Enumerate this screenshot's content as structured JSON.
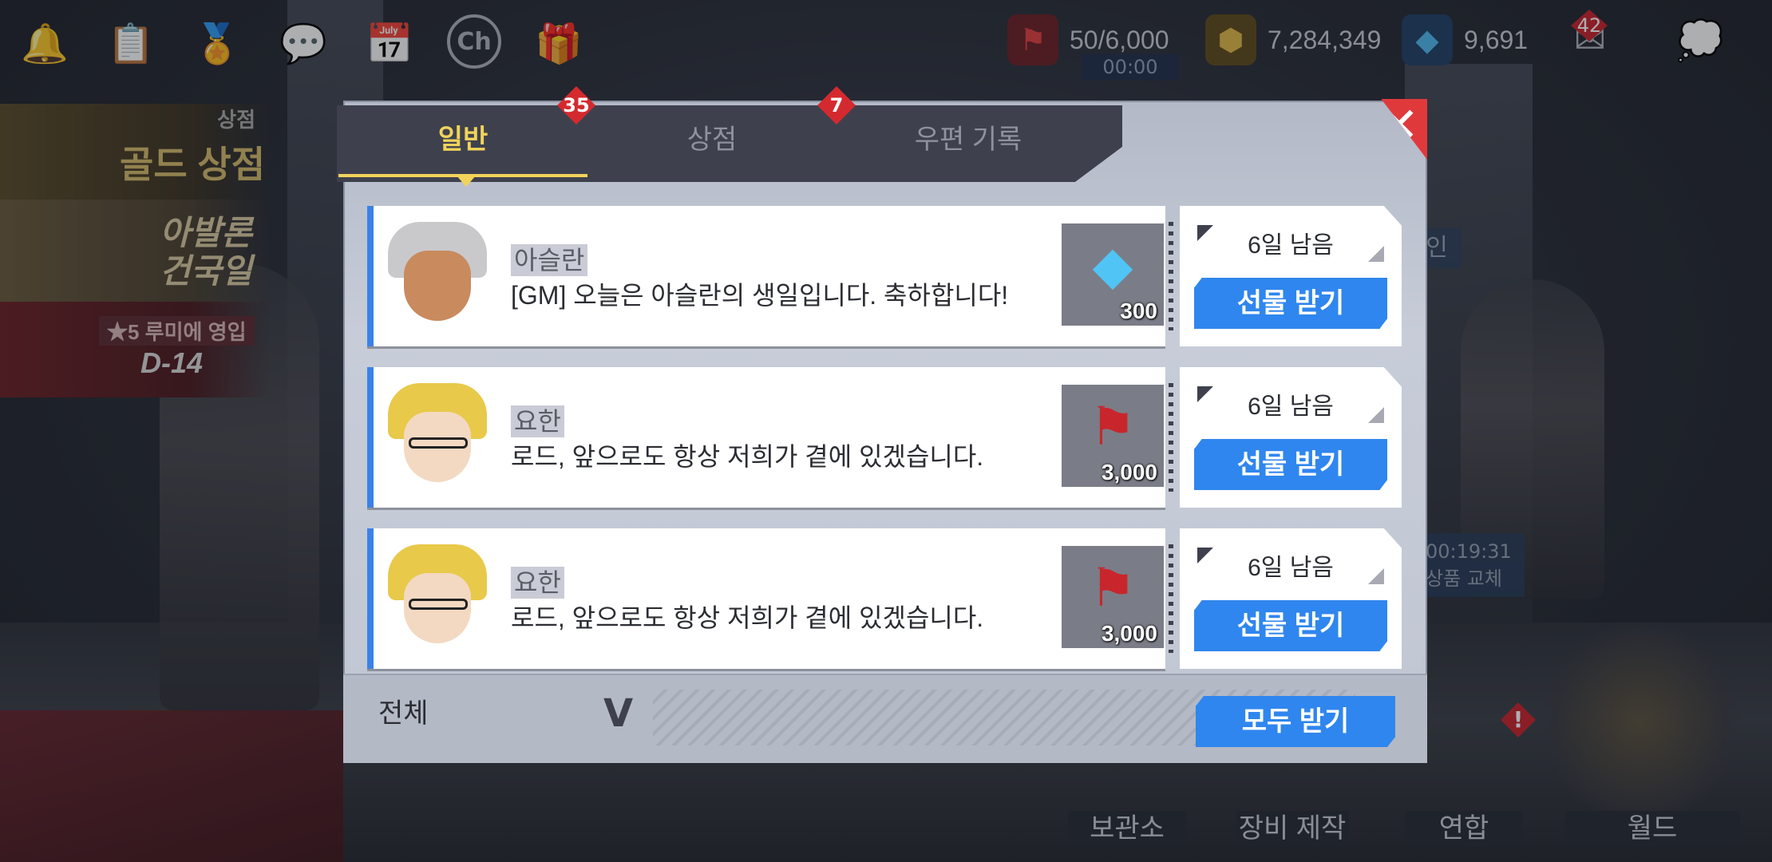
{
  "hud": {
    "top_icons": [
      "bell-icon",
      "quest-icon",
      "achievement-icon",
      "chat-icon",
      "calendar-icon",
      "channel-icon",
      "gift-icon"
    ],
    "channel_label": "Ch",
    "stamina": "50/6,000",
    "stamina_timer": "00:00",
    "gold": "7,284,349",
    "crystal": "9,691",
    "mail_count": "42"
  },
  "left_banners": {
    "shop_small": "상점",
    "shop_title": "골드 상점",
    "avalon_line1": "아발론",
    "avalon_line2": "건국일",
    "rumi_line1": "★5 루미에 영입",
    "rumi_line2": "D-14"
  },
  "right_hud": {
    "in_label": "인",
    "timer": "00:19:31",
    "timer_label": "상품 교체",
    "warn": "!",
    "menu": [
      "보관소",
      "장비 제작",
      "연합",
      "월드"
    ]
  },
  "mailbox": {
    "tabs": [
      {
        "label": "일반",
        "badge": "35",
        "active": true
      },
      {
        "label": "상점",
        "badge": "7",
        "active": false
      },
      {
        "label": "우편 기록",
        "badge": "",
        "active": false
      }
    ],
    "close_icon": "✕",
    "mails": [
      {
        "sender": "아슬란",
        "message": "[GM] 오늘은 아슬란의 생일입니다. 축하합니다!",
        "item_icon": "crystal-icon",
        "qty": "300",
        "remaining": "6일 남음",
        "button": "선물 받기"
      },
      {
        "sender": "요한",
        "message": "로드, 앞으로도 항상 저희가 곁에 있겠습니다.",
        "item_icon": "stamina-flag-icon",
        "qty": "3,000",
        "remaining": "6일 남음",
        "button": "선물 받기"
      },
      {
        "sender": "요한",
        "message": "로드, 앞으로도 항상 저희가 곁에 있겠습니다.",
        "item_icon": "stamina-flag-icon",
        "qty": "3,000",
        "remaining": "6일 남음",
        "button": "선물 받기"
      }
    ],
    "filter_label": "전체",
    "filter_arrow": "V",
    "receive_all": "모두 받기"
  }
}
